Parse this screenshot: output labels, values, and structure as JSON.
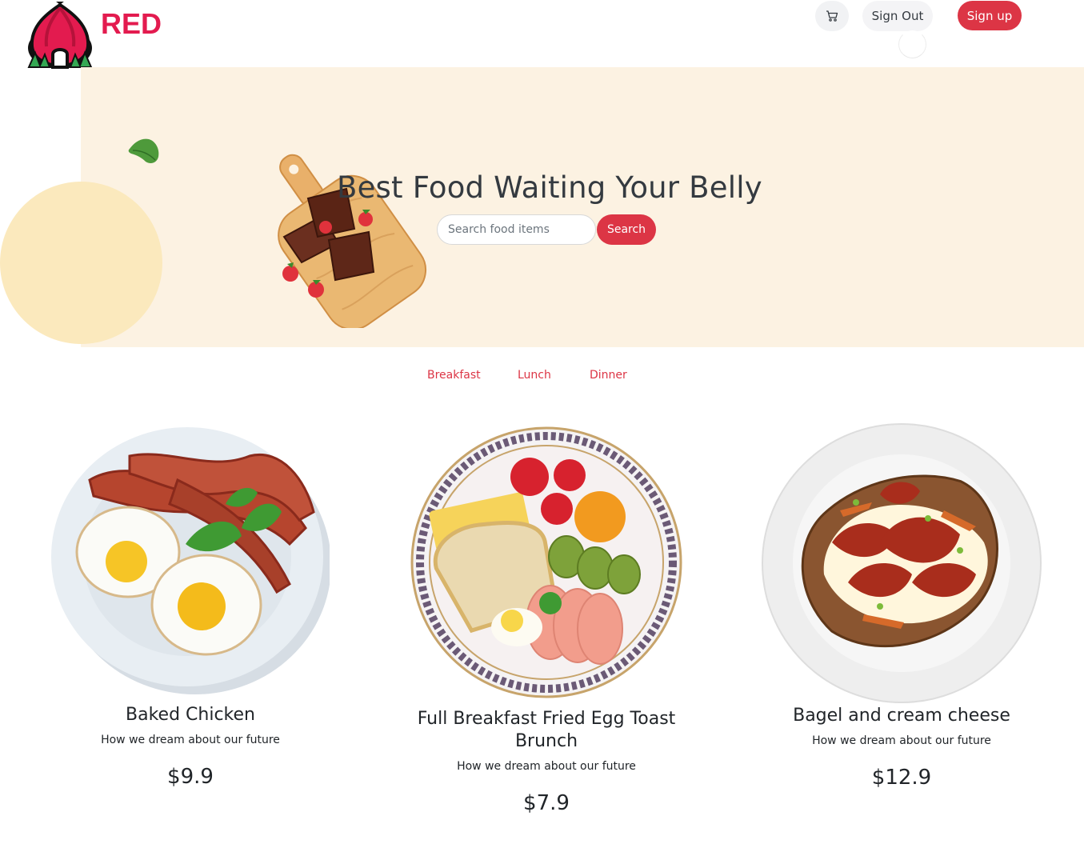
{
  "header": {
    "brand": "RED",
    "cart_icon": "cart-icon",
    "sign_out_label": "Sign Out",
    "sign_up_label": "Sign up"
  },
  "hero": {
    "title": "Best Food Waiting Your Belly",
    "search": {
      "placeholder": "Search food items",
      "button_label": "Search"
    }
  },
  "tabs": [
    {
      "label": "Breakfast"
    },
    {
      "label": "Lunch"
    },
    {
      "label": "Dinner"
    }
  ],
  "foods": [
    {
      "name": "Baked Chicken",
      "description": "How we dream about our future",
      "price": "$9.9"
    },
    {
      "name": "Full Breakfast Fried Egg Toast Brunch",
      "description": "How we dream about our future",
      "price": "$7.9"
    },
    {
      "name": "Bagel and cream cheese",
      "description": "How we dream about our future",
      "price": "$12.9"
    }
  ],
  "colors": {
    "brand": "#e31b4f",
    "accent": "#dc3545",
    "hero_bg": "#fcf2e2",
    "hero_circle": "#fbe9bd"
  }
}
